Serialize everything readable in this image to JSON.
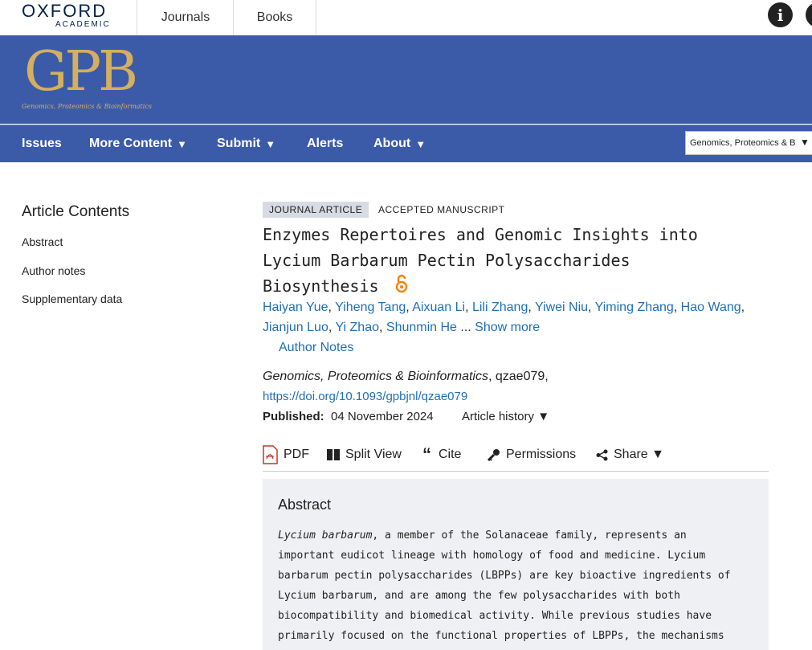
{
  "brand": {
    "oxford": "OXFORD",
    "academic": "ACADEMIC"
  },
  "topnav": {
    "journals": "Journals",
    "books": "Books",
    "info_icon": "i"
  },
  "journal_logo": {
    "text": "GPB",
    "subtitle": "Genomics, Proteomics & Bioinformatics"
  },
  "nav": {
    "items": [
      {
        "label": "Issues",
        "has_dropdown": false
      },
      {
        "label": "More Content",
        "has_dropdown": true
      },
      {
        "label": "Submit",
        "has_dropdown": true
      },
      {
        "label": "Alerts",
        "has_dropdown": false
      },
      {
        "label": "About",
        "has_dropdown": true
      }
    ],
    "caret": "▼",
    "journal_select": "Genomics, Proteomics & B"
  },
  "sidebar": {
    "title": "Article Contents",
    "items": [
      "Abstract",
      "Author notes",
      "Supplementary data"
    ]
  },
  "article": {
    "type_tag": "JOURNAL ARTICLE",
    "status_tag": "ACCEPTED MANUSCRIPT",
    "title_lines": [
      "Enzymes Repertoires and Genomic Insights into",
      "Lycium Barbarum Pectin Polysaccharides",
      "Biosynthesis"
    ],
    "authors": [
      "Haiyan Yue",
      "Yiheng Tang",
      "Aixuan Li",
      "Lili Zhang",
      "Yiwei Niu",
      "Yiming Zhang",
      "Hao Wang",
      "Jianjun Luo",
      "Yi Zhao",
      "Shunmin He"
    ],
    "ellipsis": " ... ",
    "show_more": "Show more",
    "author_notes": "Author Notes",
    "journal": "Genomics, Proteomics & Bioinformatics",
    "article_id": ", qzae079,",
    "doi": "https://doi.org/10.1093/gpbjnl/qzae079",
    "published_label": "Published:",
    "published_date": "04 November 2024",
    "history": "Article history"
  },
  "toolbar": {
    "pdf": "PDF",
    "split_view": "Split View",
    "cite": "Cite",
    "permissions": "Permissions",
    "share": "Share"
  },
  "abstract": {
    "heading": "Abstract",
    "first_italic": "Lycium barbarum",
    "lines": [
      ", a member of the Solanaceae family, represents an",
      "important eudicot lineage with homology of food and medicine. Lycium",
      "barbarum pectin polysaccharides (LBPPs) are key bioactive ingredients of",
      "Lycium barbarum, and are among the few polysaccharides with both",
      "biocompatibility and biomedical activity. While previous studies have",
      "primarily focused on the functional properties of LBPPs, the mechanisms"
    ]
  },
  "colors": {
    "brand_blue": "#3b5ba9",
    "link_blue": "#1f6fb5",
    "gold": "#d4af5f",
    "oa_orange": "#f68212",
    "pdf_red": "#c0392b"
  }
}
